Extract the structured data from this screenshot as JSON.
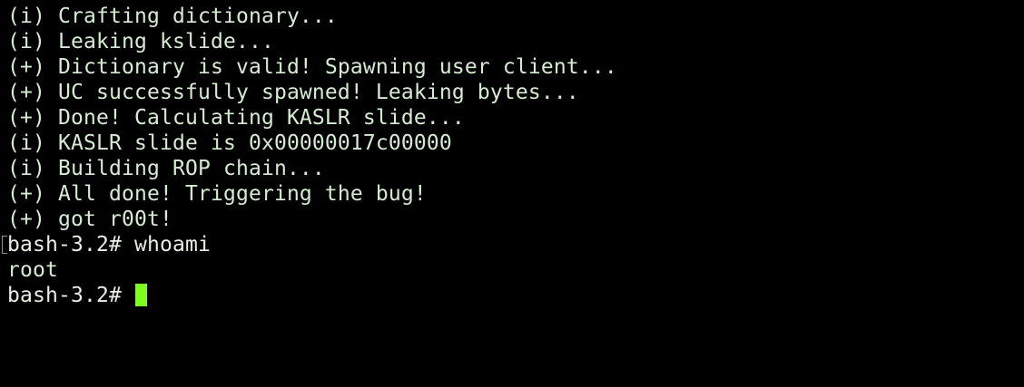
{
  "terminal": {
    "lines": [
      "(i) Crafting dictionary...",
      "(i) Leaking kslide...",
      "(+) Dictionary is valid! Spawning user client...",
      "(+) UC successfully spawned! Leaking bytes...",
      "(+) Done! Calculating KASLR slide...",
      "(i) KASLR slide is 0x00000017c00000",
      "(i) Building ROP chain...",
      "(+) All done! Triggering the bug!",
      "(+) got r00t!",
      "bash-3.2# whoami",
      "root"
    ],
    "prompt": "bash-3.2# ",
    "cursor_color": "#7cff1c",
    "text_color": "#d6ecd2",
    "background_color": "#000000"
  }
}
